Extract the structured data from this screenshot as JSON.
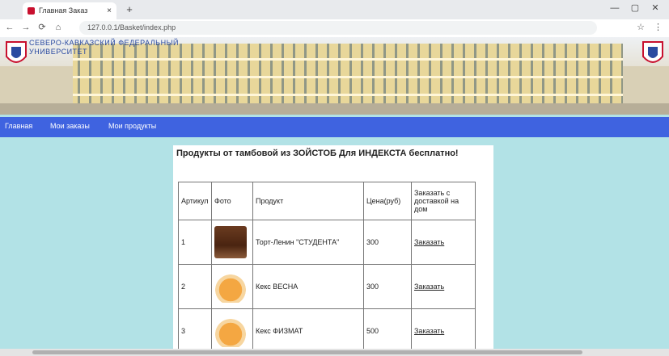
{
  "browser": {
    "tab_title": "Главная Заказ",
    "tab_close": "×",
    "new_tab": "+",
    "window_controls": [
      "—",
      "▢",
      "✕"
    ],
    "nav": {
      "back": "←",
      "forward": "→",
      "reload": "⟳",
      "home": "⌂"
    },
    "address": "127.0.0.1/Basket/index.php"
  },
  "banner": {
    "university_name_line1": "СЕВЕРО-КАВКАЗСКИЙ ФЕДЕРАЛЬНЫЙ",
    "university_name_line2": "УНИВЕРСИТЕТ"
  },
  "menu": {
    "items": [
      "Главная",
      "Мои заказы",
      "Мои продукты"
    ]
  },
  "content": {
    "heading": "Продукты от тамбовой из ЗОЙСТОБ Для ИНДЕКСТА бесплатно!",
    "table": {
      "headers": [
        "Артикул",
        "Фото",
        "Продукт",
        "Цена(руб)",
        "Заказать с доставкой на дом"
      ],
      "rows": [
        {
          "article": "1",
          "photo": "cake",
          "product": "Торт-Ленин \"СТУДЕНТА\"",
          "price": "300",
          "order": "Заказать"
        },
        {
          "article": "2",
          "photo": "muffin",
          "product": "Кекс ВЕСНА",
          "price": "300",
          "order": "Заказать"
        },
        {
          "article": "3",
          "photo": "muffin",
          "product": "Кекс ФИЗМАТ",
          "price": "500",
          "order": "Заказать"
        }
      ]
    }
  }
}
